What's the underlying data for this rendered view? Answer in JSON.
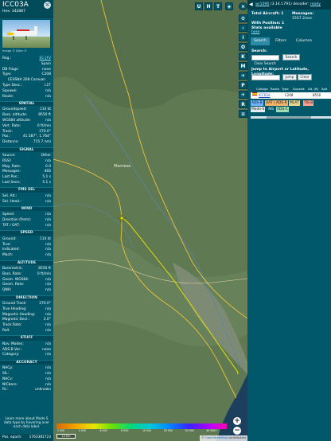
{
  "aircraft": {
    "callsign": "ICC03A",
    "hex_label": "Hex:",
    "hex": "3428B7",
    "image_credit": "Image © Björn Ö"
  },
  "info_rows": [
    {
      "k": "Reg.:",
      "v": "EC-JFV",
      "link": true
    },
    {
      "k": "",
      "v": "Spain"
    },
    {
      "k": "DB Flags:",
      "v": "none"
    },
    {
      "k": "Type:",
      "v": "C208"
    },
    {
      "k": "",
      "v": "CESSNA 208 Caravan",
      "center": true
    },
    {
      "k": "Type Desc.:",
      "v": "L1T"
    },
    {
      "k": "Squawk:",
      "v": "n/a"
    },
    {
      "k": "Route:",
      "v": "n/a"
    }
  ],
  "sections": [
    {
      "title": "SPATIAL",
      "rows": [
        {
          "k": "Groundspeed:",
          "v": "114 kt"
        },
        {
          "k": "Baro. altitude:",
          "v": "8550 ft"
        },
        {
          "k": "WGS84 altitude:",
          "v": "n/a"
        },
        {
          "k": "Vert. Rate:",
          "v": "0 ft/min"
        },
        {
          "k": "Track:",
          "v": "270.0°"
        },
        {
          "k": "Pos.:",
          "v": "41.587°, 1.764°"
        },
        {
          "k": "Distance:",
          "v": "715.7 nmi"
        }
      ]
    },
    {
      "title": "SIGNAL",
      "rows": [
        {
          "k": "Source:",
          "v": "Other"
        },
        {
          "k": "RSSI:",
          "v": "n/a"
        },
        {
          "k": "Msg. Rate:",
          "v": "0.0"
        },
        {
          "k": "Messages:",
          "v": "466"
        },
        {
          "k": "Last Pos.:",
          "v": "5.1 s"
        },
        {
          "k": "Last Seen:",
          "v": "5.1 s"
        }
      ]
    },
    {
      "title": "FMS SEL",
      "rows": [
        {
          "k": "Sel. Alt.:",
          "v": "n/a"
        },
        {
          "k": "Sel. Head.:",
          "v": "n/a"
        }
      ]
    },
    {
      "title": "WIND",
      "rows": [
        {
          "k": "Speed:",
          "v": "n/a"
        },
        {
          "k": "Direction (from):",
          "v": "n/a"
        },
        {
          "k": "TAT / OAT:",
          "v": "n/a"
        }
      ]
    },
    {
      "title": "SPEED",
      "rows": [
        {
          "k": "Ground:",
          "v": "114 kt"
        },
        {
          "k": "True:",
          "v": "n/a"
        },
        {
          "k": "Indicated:",
          "v": "n/a"
        },
        {
          "k": "Mach:",
          "v": "n/a"
        }
      ]
    },
    {
      "title": "ALTITUDE",
      "rows": [
        {
          "k": "Barometric:",
          "v": "8550 ft"
        },
        {
          "k": "Baro. Rate:",
          "v": "0 ft/min"
        },
        {
          "k": "Geom. WGS84:",
          "v": "n/a"
        },
        {
          "k": "Geom. Rate:",
          "v": "n/a"
        },
        {
          "k": "QNH:",
          "v": "n/a"
        }
      ]
    },
    {
      "title": "DIRECTION",
      "rows": [
        {
          "k": "Ground Track:",
          "v": "270.0°"
        },
        {
          "k": "True Heading:",
          "v": "n/a"
        },
        {
          "k": "Magnetic Heading:",
          "v": "n/a"
        },
        {
          "k": "Magnetic Decl.:",
          "v": "2.0°"
        },
        {
          "k": "Track Rate:",
          "v": "n/a"
        },
        {
          "k": "Roll:",
          "v": "n/a"
        }
      ]
    },
    {
      "title": "STUFF",
      "rows": [
        {
          "k": "Nav. Modes:",
          "v": "n/a"
        },
        {
          "k": "ADS-B Ver.:",
          "v": "none"
        },
        {
          "k": "Category:",
          "v": "n/a"
        }
      ]
    },
    {
      "title": "ACCURACY",
      "rows": [
        {
          "k": "NACp:",
          "v": "n/a"
        },
        {
          "k": "SIL:",
          "v": "n/a"
        },
        {
          "k": "NACv:",
          "v": "n/a"
        },
        {
          "k": "NICbaro:",
          "v": "n/a"
        },
        {
          "k": "Rc:",
          "v": "unknown"
        }
      ]
    }
  ],
  "footer_note": "Learn more about Mode S data type by hovering over each data label.",
  "pos_epoch": {
    "k": "Pos. epoch:",
    "v": "1763381723"
  },
  "map": {
    "top_buttons": [
      "U",
      "H",
      "T"
    ],
    "zoom_in": "+",
    "zoom_out": "−",
    "place_label": "Manresa",
    "scale_label": "10 km",
    "attribution_prefix": "©",
    "attribution_link": "OpenStreetMap",
    "attribution_suffix": "contributors",
    "altitude_labels": [
      "2 000",
      "4 000",
      "6 000",
      "8 000",
      "10 000",
      "20 000",
      "30 000",
      "40 000+"
    ],
    "colors": {
      "track": "#e6e000",
      "map_bg": "#5f7a53",
      "road": "#f0c23a",
      "sea": "#1c3f5e"
    }
  },
  "side_buttons": [
    "I",
    "O",
    "K",
    "M",
    "P",
    "R"
  ],
  "side_icons": [
    "close-icon",
    "gear-icon",
    "chevron-left-icon",
    "pin-icon",
    "pin-icon",
    "filter-icon",
    "expand-icon"
  ],
  "right": {
    "version_arrow": "◀",
    "version_link": "wr1090",
    "version_text": "(3.14.1791) decoder:",
    "version_status": "ready",
    "total_label": "Total Aircraft:",
    "total_value": "1",
    "messages_label": "Messages:",
    "messages_value": "1557.2/sec",
    "with_pos_label": "With Position:",
    "with_pos_value": "1",
    "stats_label": "Stats available",
    "stats_link": "here",
    "tabs": [
      "Search",
      "Filters",
      "Columns"
    ],
    "search_label": "Search:",
    "search_button": "Search",
    "clear_search": "Clear Search",
    "jump_label": "Jump to Airport or Latitude, Longitude:",
    "jump_button": "Jump",
    "clear_button": "Clear",
    "columns": [
      "Callsign",
      "Route",
      "Type",
      "Squawk",
      "Alt. (ft)",
      "Spd"
    ],
    "rows": [
      {
        "callsign": "ICC03A",
        "route": "",
        "type": "C208",
        "squawk": "",
        "alt": "8550",
        "spd": ""
      }
    ],
    "legend": [
      {
        "label": "ADS-B",
        "color": "#6fb2ff"
      },
      {
        "label": "UAT / ADS-R",
        "color": "#f3b16a"
      },
      {
        "label": "MLAT",
        "color": "#e7d78e"
      },
      {
        "label": "TIS-B",
        "color": "#ff9f8f"
      },
      {
        "label": "Mode-S",
        "color": "#e6edf0"
      },
      {
        "label": "AIS",
        "color": "#00586a"
      },
      {
        "label": "ADS-C",
        "color": "#9fdcb0"
      }
    ]
  }
}
